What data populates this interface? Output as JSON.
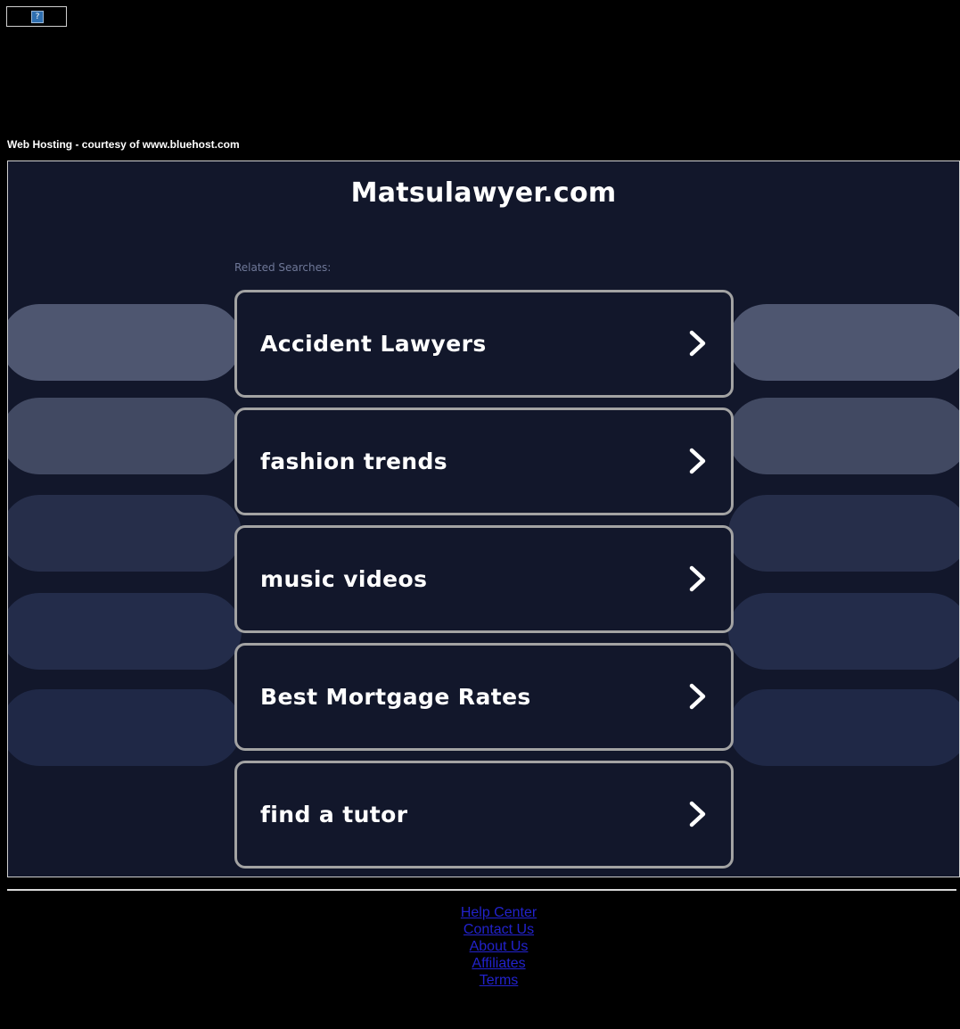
{
  "header": {
    "broken_image_glyph": "?",
    "hosting_text": "Web Hosting - courtesy of www.bluehost.com"
  },
  "main": {
    "site_title": "Matsulawyer.com",
    "related_label": "Related Searches:",
    "searches": [
      {
        "label": "Accident Lawyers"
      },
      {
        "label": "fashion trends"
      },
      {
        "label": "music videos"
      },
      {
        "label": "Best Mortgage Rates"
      },
      {
        "label": "find a tutor"
      }
    ]
  },
  "footer": {
    "links": [
      {
        "label": "Help Center"
      },
      {
        "label": "Contact Us"
      },
      {
        "label": "About Us"
      },
      {
        "label": "Affiliates"
      },
      {
        "label": "Terms"
      }
    ]
  },
  "colors": {
    "page_bg": "#000000",
    "panel_bg": "#12172b",
    "card_border": "#a3a3a3",
    "link": "#2222cc",
    "pill_shades": [
      "#4e5670",
      "#414962",
      "#262e4a",
      "#232c4a",
      "#1f2846"
    ]
  },
  "icons": {
    "card_arrow": "chevron-right-icon",
    "top_placeholder": "broken-image-icon"
  }
}
